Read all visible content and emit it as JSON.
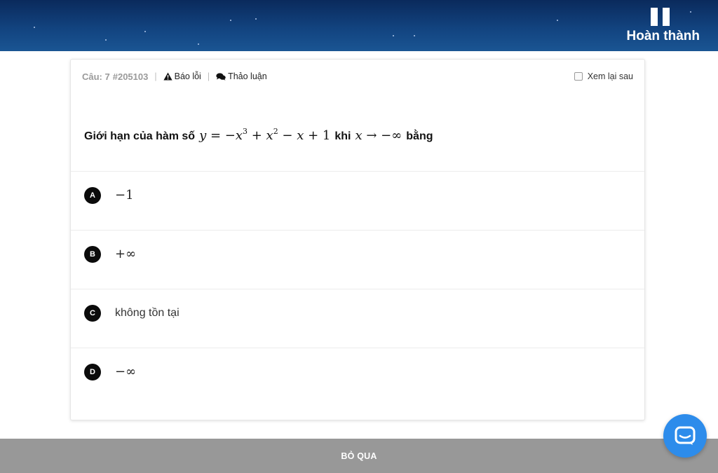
{
  "header": {
    "finish_label": "Hoàn thành",
    "pause_icon": "pause-icon"
  },
  "question_meta": {
    "label": "Câu: 7",
    "id": "#205103",
    "report_label": "Báo lỗi",
    "report_icon": "warning-icon",
    "discuss_label": "Thảo luận",
    "discuss_icon": "chat-bubbles-icon",
    "review_later_label": "Xem lại sau",
    "review_later_checked": false
  },
  "question": {
    "prefix": "Giới hạn của hàm số",
    "middle": "khi",
    "suffix": "bằng",
    "function_math": "y = −x³ + x² − x + 1",
    "limit_math": "x → −∞"
  },
  "answers": [
    {
      "letter": "A",
      "text": "−1"
    },
    {
      "letter": "B",
      "text": "+∞"
    },
    {
      "letter": "C",
      "text": "không tồn tại"
    },
    {
      "letter": "D",
      "text": "−∞"
    }
  ],
  "footer": {
    "skip_label": "BỎ QUA"
  },
  "chat_widget": {
    "icon": "chat-icon",
    "color": "#2d8ceb"
  },
  "colors": {
    "header_dark": "#0a2a5c",
    "header_light": "#1a5593",
    "skip_bar": "#989898",
    "answer_badge": "#0b0b0b"
  }
}
